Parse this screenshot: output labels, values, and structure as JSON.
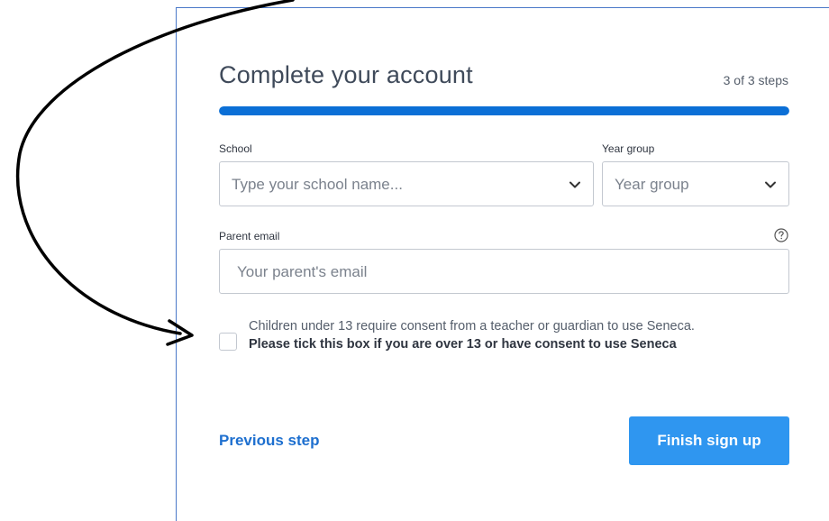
{
  "form": {
    "title": "Complete your account",
    "step_indicator": "3 of 3 steps",
    "progress_fraction": 1.0,
    "school": {
      "label": "School",
      "placeholder": "Type your school name..."
    },
    "year_group": {
      "label": "Year group",
      "placeholder": "Year group"
    },
    "parent_email": {
      "label": "Parent email",
      "placeholder": "Your parent's email"
    },
    "consent": {
      "text": "Children under 13 require consent from a teacher or guardian to use Seneca.",
      "bold_text": "Please tick this box if you are over 13 or have consent to use Seneca",
      "checked": false
    },
    "previous_label": "Previous step",
    "finish_label": "Finish sign up"
  },
  "colors": {
    "accent": "#0b6fd6",
    "button": "#2f96f0",
    "link": "#1d6fcf",
    "card_border": "#4a78c8"
  },
  "icons": {
    "dropdown": "chevron-down-icon",
    "help": "question-circle-icon",
    "annotation": "curved-arrow-icon"
  }
}
